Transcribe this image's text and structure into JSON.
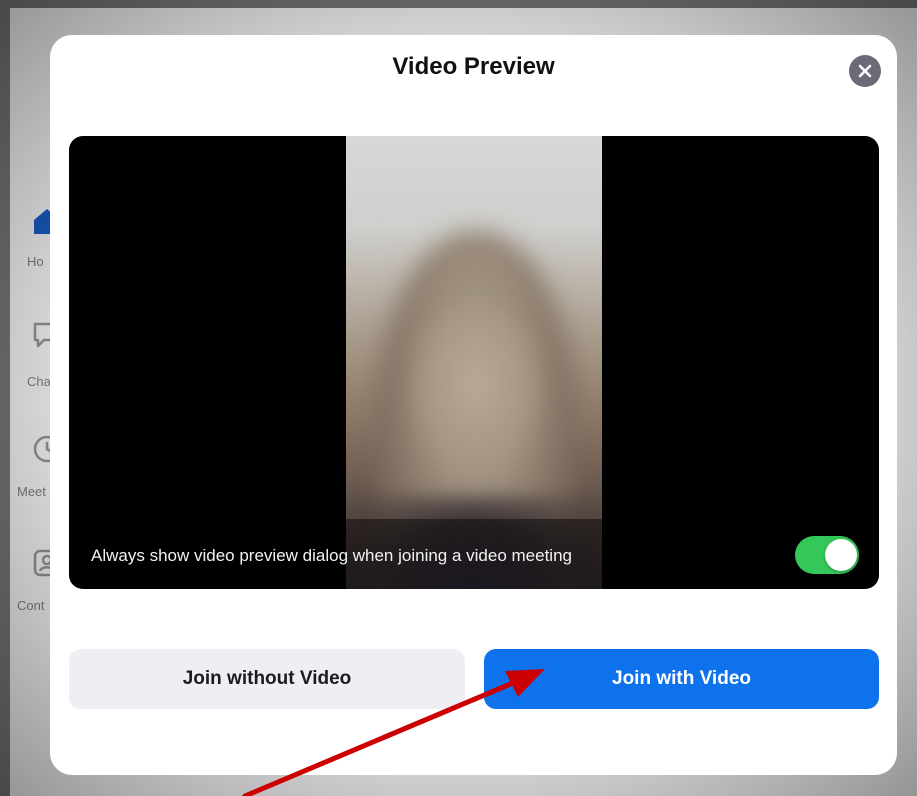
{
  "background_app": {
    "nav_items": [
      {
        "label": "Ho",
        "icon": "home-icon"
      },
      {
        "label": "Cha",
        "icon": "chat-icon"
      },
      {
        "label": "Meet",
        "icon": "clock-icon"
      },
      {
        "label": "Cont",
        "icon": "contacts-icon"
      }
    ],
    "accent_color": "#0e72ed"
  },
  "dialog": {
    "title": "Video Preview",
    "close_icon": "close-icon",
    "preview_toggle_label": "Always show video preview dialog when joining a video meeting",
    "preview_toggle_on": true,
    "toggle_color": "#34c759",
    "join_without_video_label": "Join without Video",
    "join_with_video_label": "Join with Video",
    "primary_button_color": "#0e72ed"
  },
  "annotation": {
    "type": "arrow",
    "color": "#cc0000"
  }
}
